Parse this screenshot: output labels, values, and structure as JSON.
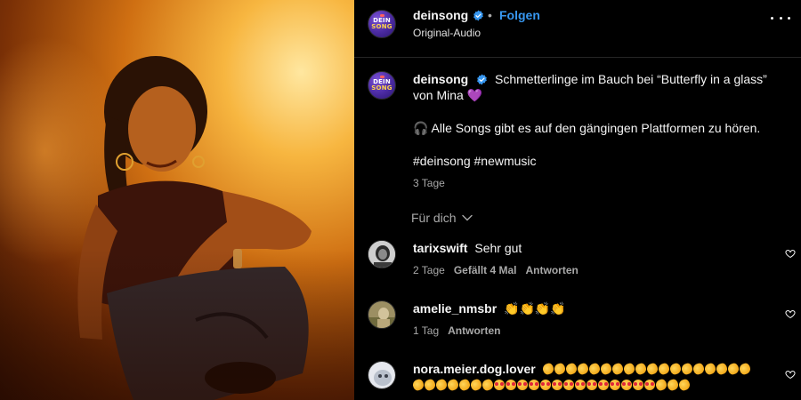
{
  "post": {
    "username": "deinsong",
    "follow_label": "Folgen",
    "separator": "•",
    "audio_label": "Original-Audio",
    "avatar_text_1": "DEIN",
    "avatar_text_2": "SONG"
  },
  "caption": {
    "username": "deinsong",
    "text": "Schmetterlinge im Bauch bei “Butterfly in a glass” von Mina 💜",
    "line2": "🎧 Alle Songs gibt es auf den gängingen Plattformen zu hören.",
    "hashtags": "#deinsong #newmusic",
    "time": "3 Tage"
  },
  "translate_label": "Für dich",
  "comments": [
    {
      "username": "tarixswift",
      "text": "Sehr gut",
      "time": "2 Tage",
      "likes": "Gefällt 4 Mal",
      "reply": "Antworten"
    },
    {
      "username": "amelie_nmsbr",
      "text": "👏👏👏👏",
      "time": "1 Tag",
      "reply": "Antworten"
    },
    {
      "username": "nora.meier.dog.lover",
      "clap_count_line1": 18,
      "clap_count_line2": 7,
      "face_count": 14,
      "clap_count_tail": 3
    }
  ],
  "colors": {
    "accent_blue": "#3797f0",
    "muted_text": "#a8a8a8",
    "background": "#000000"
  },
  "icons": [
    "verified-badge-icon",
    "more-options-icon",
    "chevron-down-icon",
    "heart-icon"
  ]
}
